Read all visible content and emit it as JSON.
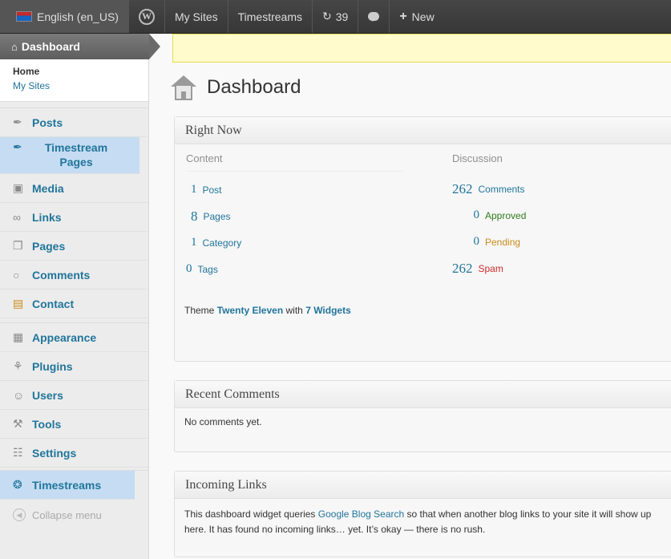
{
  "adminbar": {
    "language": "English (en_US)",
    "wp_logo_glyph": "W",
    "my_sites": "My Sites",
    "site_name": "Timestreams",
    "updates_count": "39",
    "new_label": "New"
  },
  "sidebar": {
    "dashboard": "Dashboard",
    "submenu": {
      "home": "Home",
      "my_sites": "My Sites"
    },
    "items": [
      {
        "label": "Posts",
        "icon": "pushpin-icon"
      },
      {
        "label": "Timestream Pages",
        "icon": "pushpin-icon"
      },
      {
        "label": "Media",
        "icon": "media-icon"
      },
      {
        "label": "Links",
        "icon": "links-icon"
      },
      {
        "label": "Pages",
        "icon": "pages-icon"
      },
      {
        "label": "Comments",
        "icon": "comments-icon"
      },
      {
        "label": "Contact",
        "icon": "contact-icon"
      },
      {
        "label": "Appearance",
        "icon": "appearance-icon"
      },
      {
        "label": "Plugins",
        "icon": "plugins-icon"
      },
      {
        "label": "Users",
        "icon": "users-icon"
      },
      {
        "label": "Tools",
        "icon": "tools-icon"
      },
      {
        "label": "Settings",
        "icon": "settings-icon"
      },
      {
        "label": "Timestreams",
        "icon": "timestreams-icon"
      }
    ],
    "collapse": "Collapse menu"
  },
  "main": {
    "page_title": "Dashboard",
    "right_now": {
      "title": "Right Now",
      "content_head": "Content",
      "discussion_head": "Discussion",
      "content": [
        {
          "num": "1",
          "label": "Post"
        },
        {
          "num": "8",
          "label": "Pages"
        },
        {
          "num": "1",
          "label": "Category"
        },
        {
          "num": "0",
          "label": "Tags"
        }
      ],
      "discussion": [
        {
          "num": "262",
          "label": "Comments"
        },
        {
          "num": "0",
          "label": "Approved"
        },
        {
          "num": "0",
          "label": "Pending"
        },
        {
          "num": "262",
          "label": "Spam"
        }
      ],
      "theme_prefix": "Theme ",
      "theme_name": "Twenty Eleven",
      "theme_with": " with ",
      "widgets_link": "7 Widgets"
    },
    "recent_comments": {
      "title": "Recent Comments",
      "body": "No comments yet."
    },
    "incoming_links": {
      "title": "Incoming Links",
      "text_before": "This dashboard widget queries ",
      "link": "Google Blog Search",
      "text_after": " so that when another blog links to your site it will show up here. It has found no incoming links… yet. It’s okay — there is no rush."
    }
  },
  "colors": {
    "link": "#21759b",
    "approved": "#2e7d1c",
    "pending": "#c98b1a",
    "spam": "#cf2a2a",
    "notice_bg": "#fffbcc",
    "active_menu_bg": "#c5dcf3"
  }
}
